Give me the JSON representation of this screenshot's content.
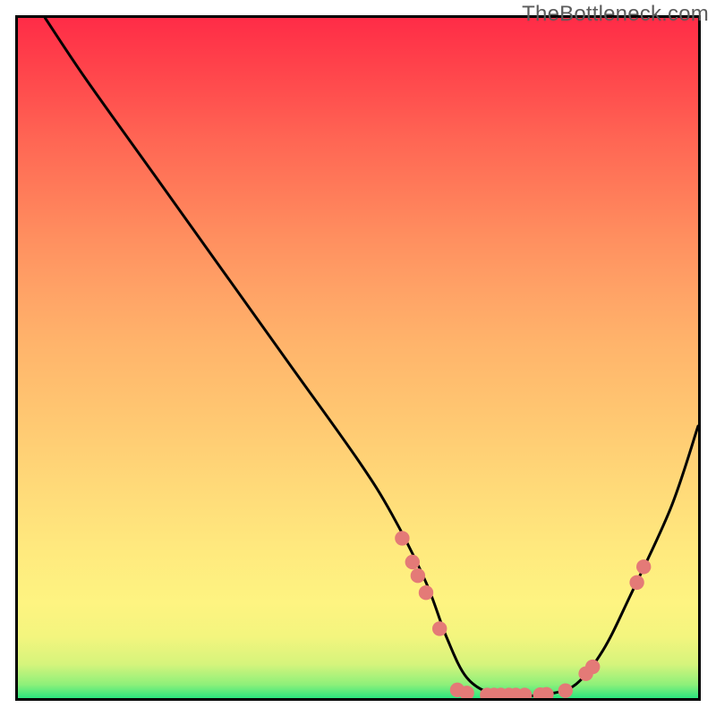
{
  "watermark": "TheBottleneck.com",
  "chart_data": {
    "type": "line",
    "title": "",
    "xlabel": "",
    "ylabel": "",
    "xlim": [
      0,
      100
    ],
    "ylim": [
      0,
      100
    ],
    "series": [
      {
        "name": "curve",
        "x": [
          4,
          10,
          20,
          30,
          40,
          50,
          55,
          60,
          63,
          66,
          70,
          74,
          78,
          82,
          86,
          90,
          96,
          100
        ],
        "y": [
          100,
          91,
          77,
          63,
          49,
          35,
          27,
          17,
          9,
          3,
          0.5,
          0.3,
          0.6,
          2,
          7,
          15,
          28,
          40
        ]
      }
    ],
    "markers": [
      {
        "x": 56.5,
        "y": 23.5
      },
      {
        "x": 58.0,
        "y": 20.0
      },
      {
        "x": 58.8,
        "y": 18.0
      },
      {
        "x": 60.0,
        "y": 15.5
      },
      {
        "x": 62.0,
        "y": 10.2
      },
      {
        "x": 64.6,
        "y": 1.2
      },
      {
        "x": 66.0,
        "y": 0.75
      },
      {
        "x": 69.0,
        "y": 0.45
      },
      {
        "x": 70.0,
        "y": 0.45
      },
      {
        "x": 71.0,
        "y": 0.45
      },
      {
        "x": 72.2,
        "y": 0.45
      },
      {
        "x": 73.2,
        "y": 0.45
      },
      {
        "x": 74.5,
        "y": 0.45
      },
      {
        "x": 76.8,
        "y": 0.5
      },
      {
        "x": 77.7,
        "y": 0.55
      },
      {
        "x": 80.5,
        "y": 1.1
      },
      {
        "x": 83.5,
        "y": 3.6
      },
      {
        "x": 84.5,
        "y": 4.6
      },
      {
        "x": 91.0,
        "y": 17.0
      },
      {
        "x": 92.0,
        "y": 19.3
      }
    ],
    "gradient_stops": [
      {
        "pos": 0,
        "color": "#2be67e"
      },
      {
        "pos": 100,
        "color": "#ff2c47"
      }
    ]
  }
}
